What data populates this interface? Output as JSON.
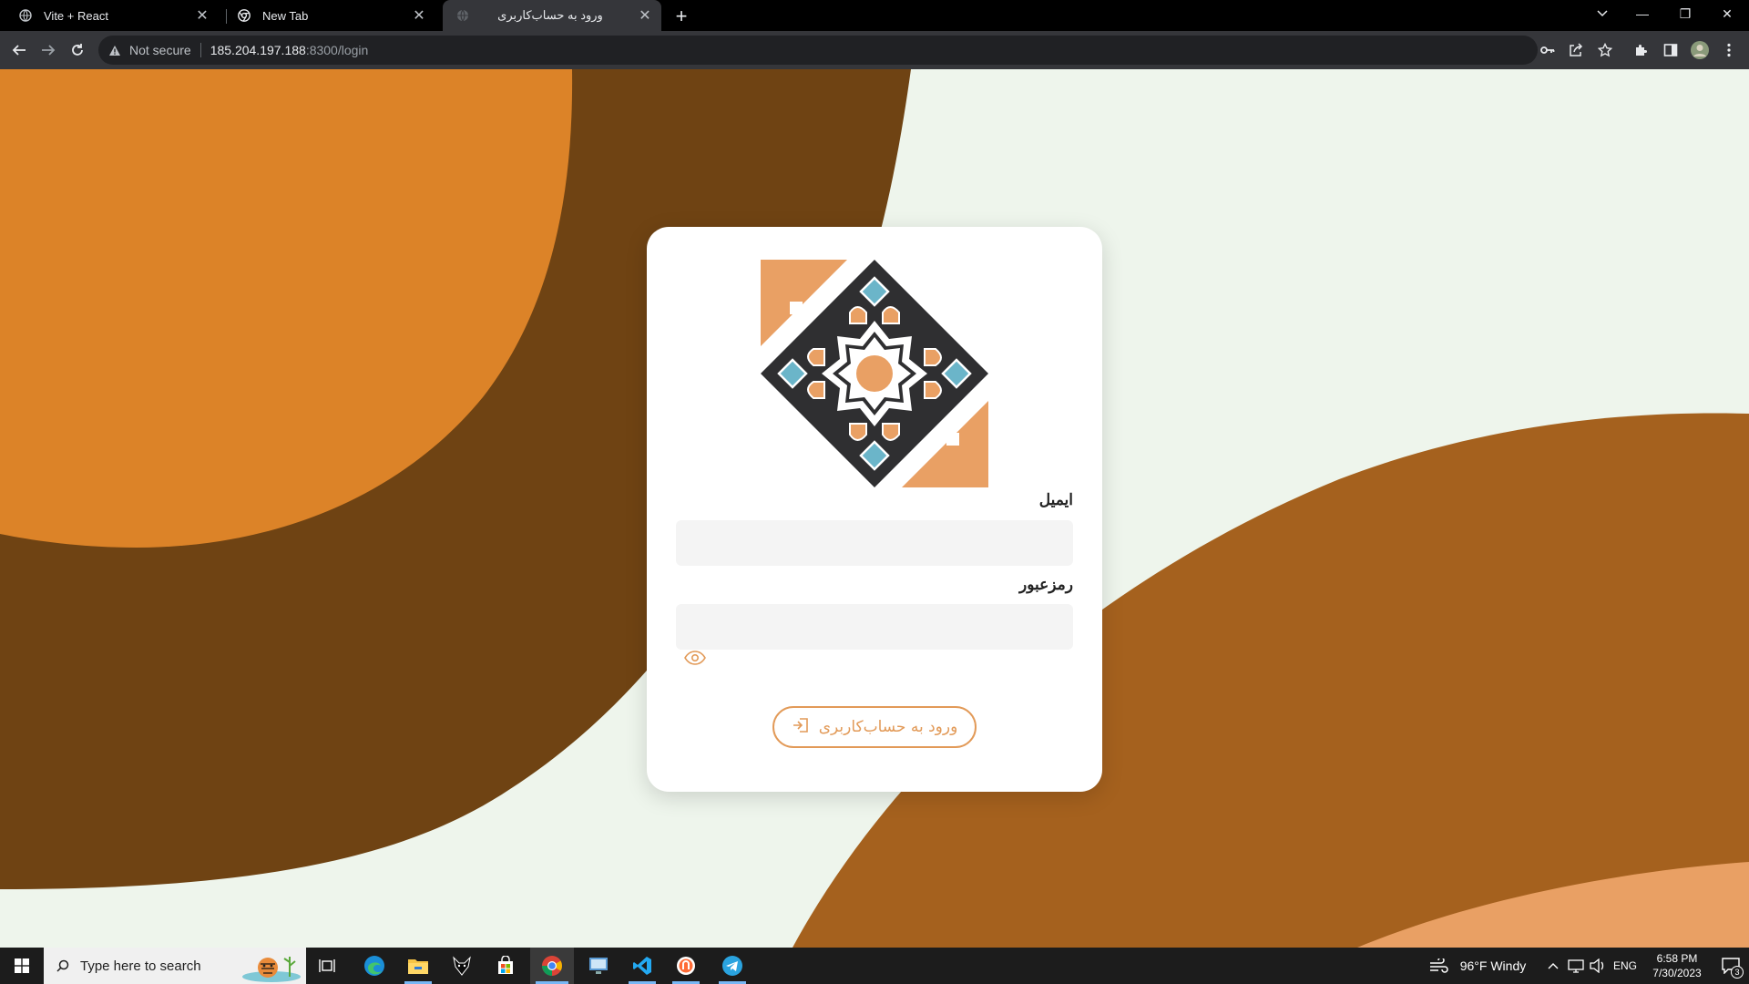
{
  "browser": {
    "tabs": [
      {
        "title": "Vite + React",
        "icon": "globe-icon",
        "close": "✕"
      },
      {
        "title": "New Tab",
        "icon": "chrome-icon",
        "close": "✕"
      },
      {
        "title": "ورود به حساب‌کاربری",
        "icon": "globe-icon",
        "close": "✕",
        "active": true
      }
    ],
    "new_tab": "+",
    "window_controls": {
      "minimize": "—",
      "restore": "❐",
      "close": "✕"
    },
    "address": {
      "security": "Not secure",
      "host": "185.204.197.188",
      "path": ":8300/login"
    }
  },
  "login": {
    "email_label": "ایمیل",
    "email_value": "",
    "password_label": "رمزعبور",
    "password_value": "",
    "submit_label": "ورود به حساب‌کاربری"
  },
  "taskbar": {
    "search_placeholder": "Type here to search",
    "weather": "96°F  Windy",
    "language": "ENG",
    "time": "6:58 PM",
    "date": "7/30/2023",
    "notifications": "3"
  },
  "colors": {
    "accent": "#e29a58",
    "bg_light": "#eef5ec",
    "orange": "#dc8328",
    "dark_brown": "#6f4313",
    "mid_brown": "#a5611e",
    "peach": "#e9a064",
    "logo_dark": "#2f2f31",
    "logo_blue": "#6bb5c9"
  }
}
